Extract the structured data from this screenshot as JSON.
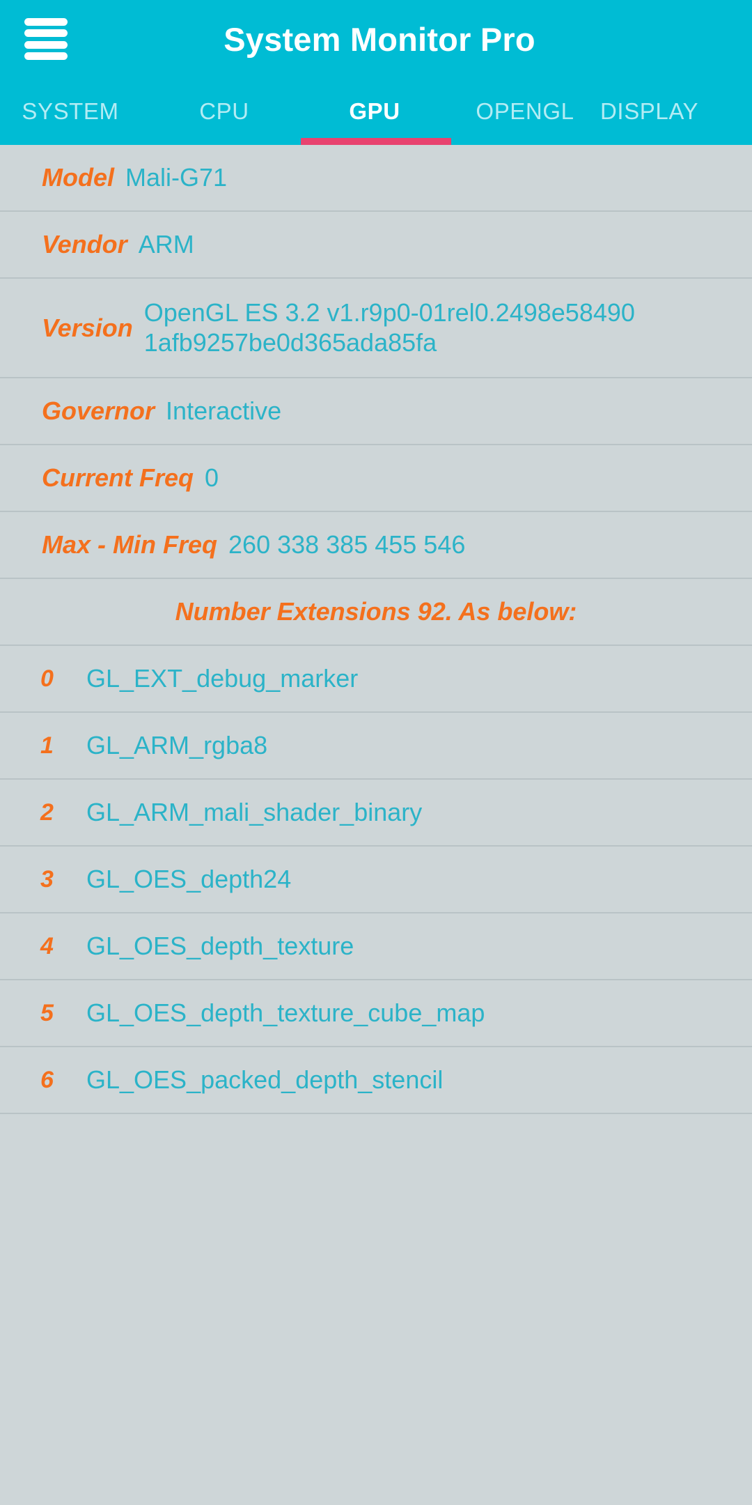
{
  "appbar": {
    "title": "System Monitor Pro",
    "menu_icon": "hamburger-menu-icon",
    "background_color": "#00bcd4",
    "title_color": "#ffffff"
  },
  "tabs": {
    "active": "GPU",
    "indicator_color": "#e8436f",
    "items": [
      {
        "label": "SYSTEM",
        "active": false
      },
      {
        "label": "CPU",
        "active": false
      },
      {
        "label": "GPU",
        "active": true
      },
      {
        "label": "OPENGL",
        "active": false
      },
      {
        "label": "DISPLAY",
        "active": false
      }
    ]
  },
  "theme": {
    "content_background": "#ced6d8",
    "label_color": "#f4701d",
    "value_color": "#2bb3c8",
    "divider_color": "#b9c3c6"
  },
  "gpu_info": [
    {
      "label": "Model",
      "value": "Mali-G71"
    },
    {
      "label": "Vendor",
      "value": "ARM"
    },
    {
      "label": "Version",
      "value": "OpenGL ES 3.2 v1.r9p0-01rel0.2498e584901afb9257be0d365ada85fa"
    },
    {
      "label": "Governor",
      "value": "Interactive"
    },
    {
      "label": "Current Freq",
      "value": "0"
    },
    {
      "label": "Max - Min Freq",
      "value": "260 338 385 455 546"
    }
  ],
  "extensions_section": {
    "title": "Number Extensions 92. As below:",
    "count": 92,
    "items": [
      {
        "index": "0",
        "name": "GL_EXT_debug_marker"
      },
      {
        "index": "1",
        "name": "GL_ARM_rgba8"
      },
      {
        "index": "2",
        "name": "GL_ARM_mali_shader_binary"
      },
      {
        "index": "3",
        "name": "GL_OES_depth24"
      },
      {
        "index": "4",
        "name": "GL_OES_depth_texture"
      },
      {
        "index": "5",
        "name": "GL_OES_depth_texture_cube_map"
      },
      {
        "index": "6",
        "name": "GL_OES_packed_depth_stencil"
      }
    ]
  }
}
